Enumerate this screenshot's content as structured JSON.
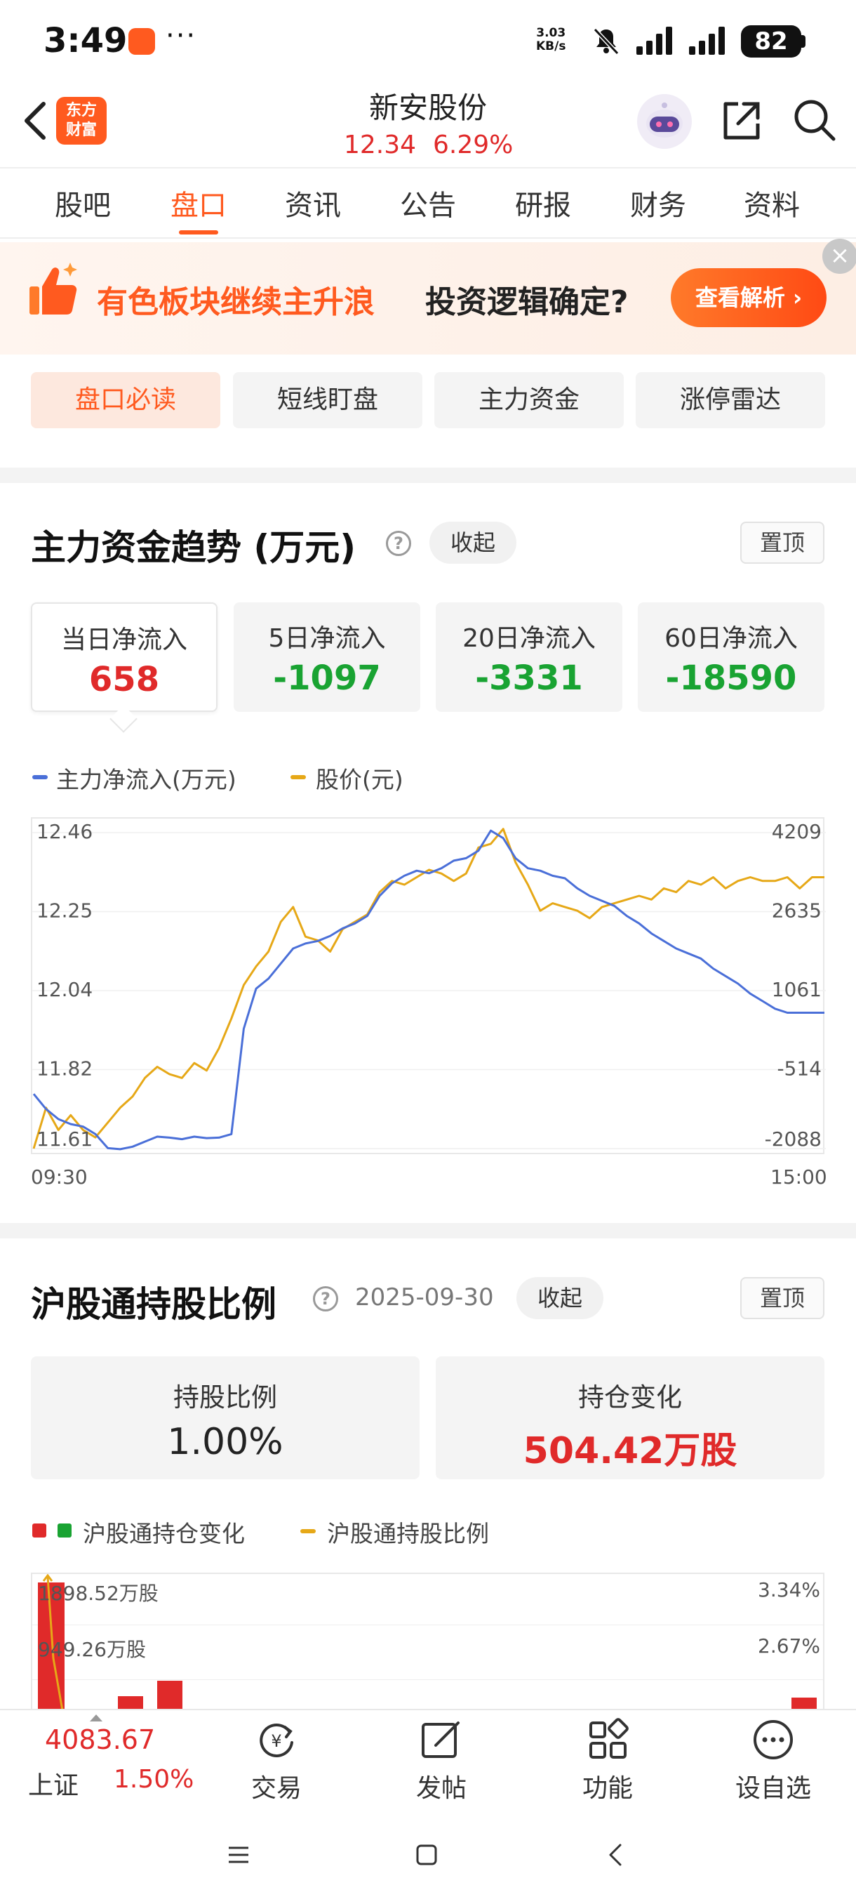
{
  "status_bar": {
    "time": "3:49",
    "dots": "···",
    "net_speed_top": "3.03",
    "net_speed_bottom": "KB/s",
    "battery": "82"
  },
  "header": {
    "logo_line1": "东方",
    "logo_line2": "财富",
    "stock_name": "新安股份",
    "price": "12.34",
    "change_pct": "6.29%"
  },
  "tabs": [
    {
      "label": "股吧"
    },
    {
      "label": "盘口"
    },
    {
      "label": "资讯"
    },
    {
      "label": "公告"
    },
    {
      "label": "研报"
    },
    {
      "label": "财务"
    },
    {
      "label": "资料"
    }
  ],
  "active_tab": "盘口",
  "banner": {
    "headline": "有色板块继续主升浪",
    "question": "投资逻辑确定?",
    "button": "查看解析 ›",
    "close": "×"
  },
  "sub_tabs": [
    {
      "label": "盘口必读"
    },
    {
      "label": "短线盯盘"
    },
    {
      "label": "主力资金"
    },
    {
      "label": "涨停雷达"
    }
  ],
  "fund_trend": {
    "title": "主力资金趋势 (万元)",
    "help": "?",
    "collapse": "收起",
    "pin": "置顶",
    "cards": [
      {
        "label": "当日净流入",
        "value": "658"
      },
      {
        "label": "5日净流入",
        "value": "-1097"
      },
      {
        "label": "20日净流入",
        "value": "-3331"
      },
      {
        "label": "60日净流入",
        "value": "-18590"
      }
    ],
    "legend": [
      {
        "label": "主力净流入(万元)",
        "color": "#4a6fd8"
      },
      {
        "label": "股价(元)",
        "color": "#e6a817"
      }
    ]
  },
  "chart_data": {
    "type": "line",
    "title": "",
    "x_start": "09:30",
    "x_end": "15:00",
    "left_axis_ticks": [
      "12.46",
      "12.25",
      "12.04",
      "11.82",
      "11.61"
    ],
    "right_axis_ticks": [
      "4209",
      "2635",
      "1061",
      "-514",
      "-2088"
    ],
    "ylim_left": [
      11.61,
      12.46
    ],
    "ylim_right": [
      -2088,
      4209
    ],
    "grid": true,
    "series": [
      {
        "name": "股价(元)",
        "axis": "left",
        "color": "#e6a817",
        "values": [
          11.61,
          11.72,
          11.66,
          11.7,
          11.66,
          11.64,
          11.68,
          11.72,
          11.75,
          11.8,
          11.83,
          11.81,
          11.8,
          11.84,
          11.82,
          11.88,
          11.96,
          12.05,
          12.1,
          12.14,
          12.22,
          12.26,
          12.18,
          12.17,
          12.14,
          12.2,
          12.22,
          12.24,
          12.3,
          12.33,
          12.32,
          12.34,
          12.36,
          12.35,
          12.33,
          12.35,
          12.42,
          12.43,
          12.47,
          12.38,
          12.32,
          12.25,
          12.27,
          12.26,
          12.25,
          12.23,
          12.26,
          12.27,
          12.28,
          12.29,
          12.28,
          12.31,
          12.3,
          12.33,
          12.32,
          12.34,
          12.31,
          12.33,
          12.34,
          12.33,
          12.33,
          12.34,
          12.31,
          12.34,
          12.34
        ]
      },
      {
        "name": "主力净流入(万元)",
        "axis": "right",
        "color": "#4a6fd8",
        "values": [
          -1000,
          -1300,
          -1500,
          -1600,
          -1650,
          -1800,
          -2080,
          -2100,
          -2050,
          -1950,
          -1850,
          -1870,
          -1900,
          -1850,
          -1880,
          -1870,
          -1800,
          300,
          1100,
          1300,
          1600,
          1900,
          2000,
          2050,
          2150,
          2300,
          2400,
          2550,
          2950,
          3200,
          3350,
          3450,
          3400,
          3500,
          3650,
          3700,
          3850,
          4250,
          4100,
          3700,
          3500,
          3450,
          3350,
          3300,
          3100,
          2950,
          2850,
          2750,
          2550,
          2400,
          2200,
          2050,
          1900,
          1800,
          1700,
          1500,
          1350,
          1200,
          1000,
          850,
          700,
          620,
          620,
          620,
          620
        ]
      }
    ]
  },
  "hk_connect": {
    "title": "沪股通持股比例",
    "help": "?",
    "date": "2025-09-30",
    "collapse": "收起",
    "pin": "置顶",
    "ratio_label": "持股比例",
    "ratio_value": "1.00%",
    "change_label": "持仓变化",
    "change_value": "504.42万股",
    "legend_bars": "沪股通持仓变化",
    "legend_line": "沪股通持股比例",
    "chart_left_ticks": [
      "1898.52万股",
      "949.26万股"
    ],
    "chart_right_ticks": [
      "3.34%",
      "2.67%"
    ]
  },
  "bottom_nav": {
    "index_value": "4083.67",
    "index_name": "上证",
    "index_pct": "1.50%",
    "items": [
      {
        "label": "交易"
      },
      {
        "label": "发帖"
      },
      {
        "label": "功能"
      },
      {
        "label": "设自选"
      }
    ]
  },
  "colors": {
    "accent": "#ff5a1f",
    "up": "#e02a2a",
    "down": "#19a332",
    "flow_line": "#4a6fd8",
    "price_line": "#e6a817"
  }
}
